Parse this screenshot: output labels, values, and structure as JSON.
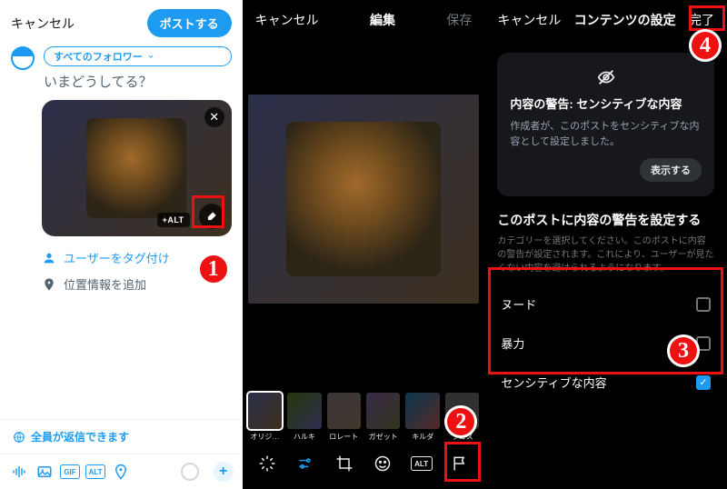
{
  "compose": {
    "cancel": "キャンセル",
    "post": "ポストする",
    "audience": "すべてのフォロワー",
    "placeholder": "いまどうしてる？",
    "alt_badge": "+ALT",
    "tag_users": "ユーザーをタグ付け",
    "add_location": "位置情報を追加",
    "reply_scope": "全員が返信できます"
  },
  "edit": {
    "cancel": "キャンセル",
    "title": "編集",
    "save": "保存",
    "filters": [
      "オリジ…",
      "ハルキ",
      "ロレート",
      "ガゼット",
      "キルダ",
      "ラゴス"
    ],
    "alt_label": "ALT"
  },
  "settings": {
    "cancel": "キャンセル",
    "title": "コンテンツの設定",
    "done": "完了",
    "warn_title": "内容の警告: センシティブな内容",
    "warn_desc": "作成者が、このポストをセンシティブな内容として設定しました。",
    "show": "表示する",
    "section": "このポストに内容の警告を設定する",
    "hint": "カテゴリーを選択してください。このポストに内容の警告が設定されます。これにより、ユーザーが見たくない内容を避けられるようになります。",
    "options": [
      {
        "label": "ヌード",
        "checked": false
      },
      {
        "label": "暴力",
        "checked": false
      },
      {
        "label": "センシティブな内容",
        "checked": true
      }
    ]
  },
  "callouts": [
    "1",
    "2",
    "3",
    "4"
  ]
}
